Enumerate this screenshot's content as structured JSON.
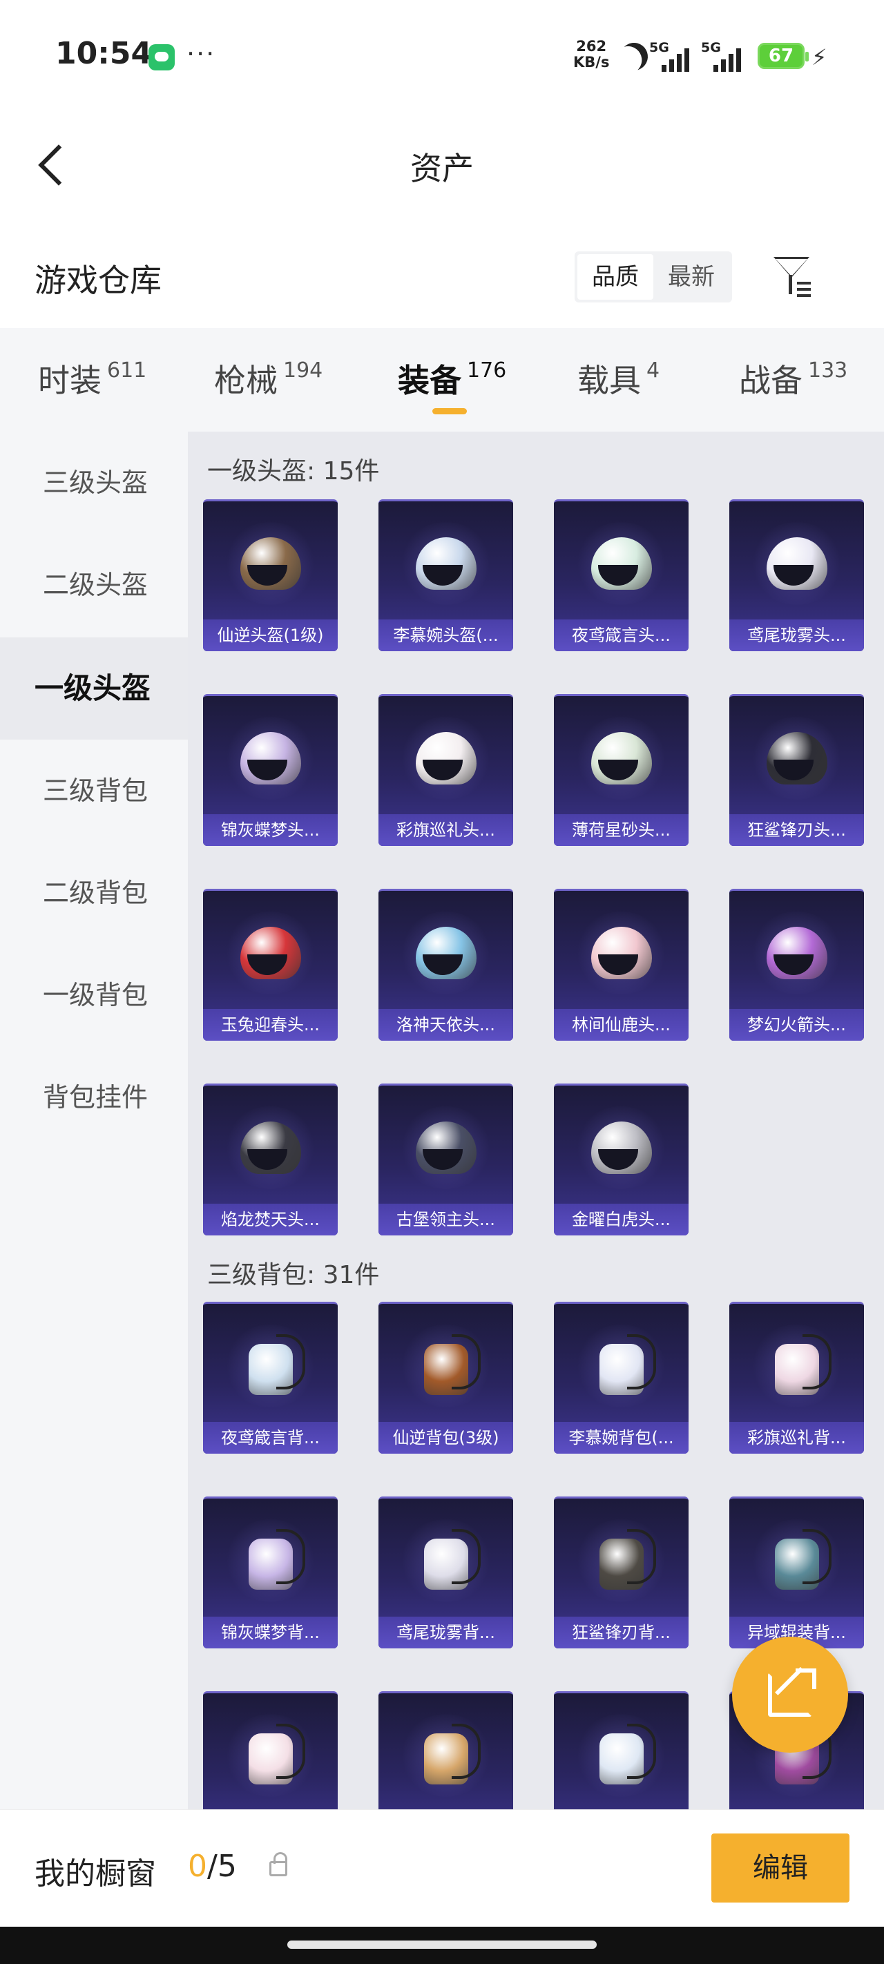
{
  "status_bar": {
    "time": "10:54",
    "net_speed_value": "262",
    "net_speed_unit": "KB/s",
    "signal_1": "5G",
    "signal_2": "5G",
    "battery": "67"
  },
  "header": {
    "title": "资产"
  },
  "section": {
    "title": "游戏仓库",
    "sort_quality": "品质",
    "sort_newest": "最新",
    "active_sort": "品质"
  },
  "tabs": [
    {
      "label": "时装",
      "count": "611"
    },
    {
      "label": "枪械",
      "count": "194"
    },
    {
      "label": "装备",
      "count": "176"
    },
    {
      "label": "载具",
      "count": "4"
    },
    {
      "label": "战备",
      "count": "133"
    }
  ],
  "active_tab": "装备",
  "sidebar": [
    {
      "label": "三级头盔"
    },
    {
      "label": "二级头盔"
    },
    {
      "label": "一级头盔"
    },
    {
      "label": "三级背包"
    },
    {
      "label": "二级背包"
    },
    {
      "label": "一级背包"
    },
    {
      "label": "背包挂件"
    }
  ],
  "active_sidebar": "一级头盔",
  "groups": [
    {
      "title": "一级头盔: 15件",
      "kind": "helmet",
      "items": [
        {
          "name": "仙逆头盔(1级)",
          "color": "#8a6a4a"
        },
        {
          "name": "李慕婉头盔(...",
          "color": "#c9d8ec"
        },
        {
          "name": "夜鸢箴言头...",
          "color": "#d7ece0"
        },
        {
          "name": "鸢尾珑雾头...",
          "color": "#e9e8f4"
        },
        {
          "name": "锦灰蝶梦头...",
          "color": "#c6b4e3"
        },
        {
          "name": "彩旗巡礼头...",
          "color": "#f3eef0"
        },
        {
          "name": "薄荷星砂头...",
          "color": "#d9e6d6"
        },
        {
          "name": "狂鲨锋刃头...",
          "color": "#2e2e36"
        },
        {
          "name": "玉兔迎春头...",
          "color": "#d6363a"
        },
        {
          "name": "洛神天依头...",
          "color": "#86c4e6"
        },
        {
          "name": "林间仙鹿头...",
          "color": "#f1c7cf"
        },
        {
          "name": "梦幻火箭头...",
          "color": "#b36ad6"
        },
        {
          "name": "焰龙焚天头...",
          "color": "#3b3b44"
        },
        {
          "name": "古堡领主头...",
          "color": "#4a4f66"
        },
        {
          "name": "金曜白虎头...",
          "color": "#bdbdc4"
        }
      ]
    },
    {
      "title": "三级背包: 31件",
      "kind": "pack",
      "items": [
        {
          "name": "夜鸢箴言背...",
          "color": "#cfe0ef"
        },
        {
          "name": "仙逆背包(3级)",
          "color": "#a25a2a"
        },
        {
          "name": "李慕婉背包(...",
          "color": "#e2e6f4"
        },
        {
          "name": "彩旗巡礼背...",
          "color": "#eed7e3"
        },
        {
          "name": "锦灰蝶梦背...",
          "color": "#c7b6e6"
        },
        {
          "name": "鸢尾珑雾背...",
          "color": "#dedde9"
        },
        {
          "name": "狂鲨锋刃背...",
          "color": "#4e4a44"
        },
        {
          "name": "异域辊装背...",
          "color": "#5a8a98"
        },
        {
          "name": "",
          "color": "#f4dfe6"
        },
        {
          "name": "",
          "color": "#d6a66a"
        },
        {
          "name": "",
          "color": "#dfe8f4"
        },
        {
          "name": "",
          "color": "#a04ca0"
        }
      ]
    }
  ],
  "showcase": {
    "label": "我的橱窗",
    "current": "0",
    "total": "/5",
    "edit_label": "编辑"
  },
  "colors": {
    "accent": "#f5b02e",
    "card_caption": "#5647b8",
    "card_bg": "#2a2560"
  }
}
